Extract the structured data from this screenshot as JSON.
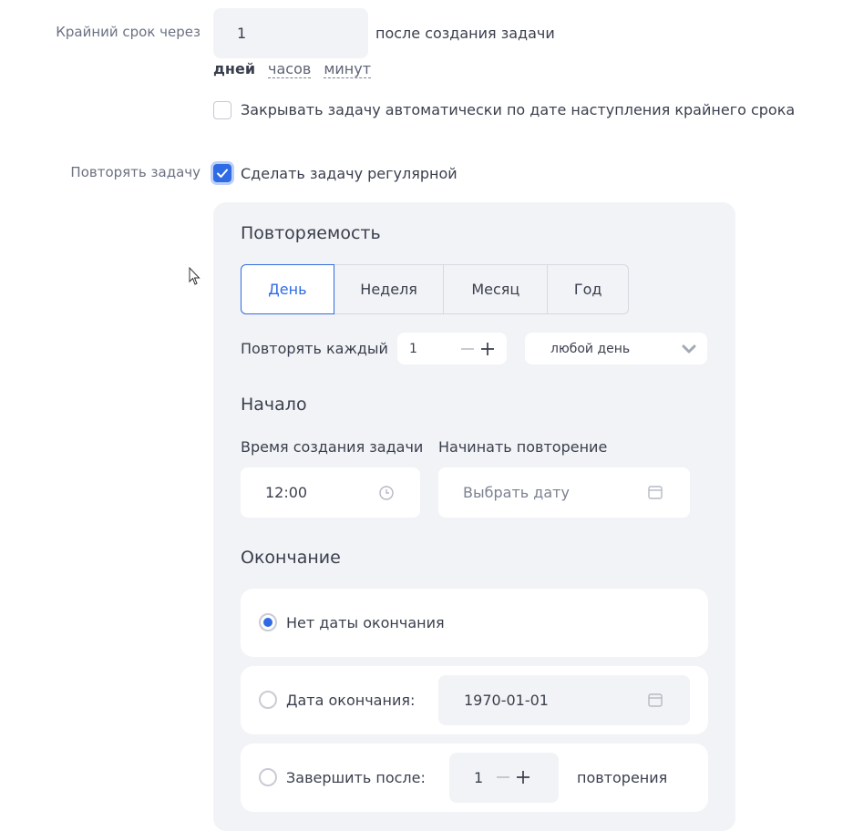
{
  "deadline": {
    "label": "Крайний срок через",
    "value": "1",
    "suffix": "после создания задачи",
    "units": [
      "дней",
      "часов",
      "минут"
    ],
    "active_unit": "дней",
    "auto_close_label": "Закрывать задачу автоматически по дате наступления крайнего срока",
    "auto_close_checked": false
  },
  "repeat": {
    "label": "Повторять задачу",
    "checkbox_label": "Сделать задачу регулярной",
    "checked": true
  },
  "recurrence": {
    "title": "Повторяемость",
    "tabs": [
      "День",
      "Неделя",
      "Месяц",
      "Год"
    ],
    "active_tab": "День",
    "repeat_every_label": "Повторять каждый",
    "repeat_every_value": "1",
    "day_select_value": "любой день"
  },
  "start": {
    "title": "Начало",
    "time_label": "Время создания задачи",
    "time_value": "12:00",
    "date_label": "Начинать повторение",
    "date_placeholder": "Выбрать дату"
  },
  "end": {
    "title": "Окончание",
    "options": [
      {
        "label": "Нет даты окончания",
        "selected": true
      },
      {
        "label": "Дата окончания:",
        "selected": false,
        "date_value": "1970-01-01"
      },
      {
        "label": "Завершить после:",
        "selected": false,
        "count_value": "1",
        "count_suffix": "повторения"
      }
    ]
  },
  "colors": {
    "accent": "#2f6be4",
    "panel_bg": "#f2f3f6",
    "text": "#3a3f4d",
    "muted": "#6b7183"
  },
  "icons": [
    "check-icon",
    "minus-icon",
    "plus-icon",
    "chevron-down-icon",
    "clock-icon",
    "calendar-icon",
    "cursor-icon"
  ]
}
